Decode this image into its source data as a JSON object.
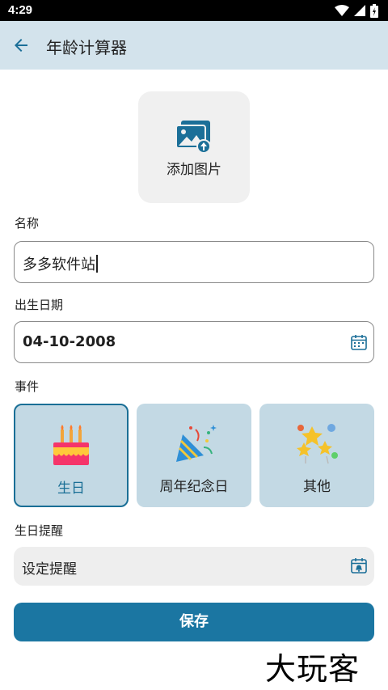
{
  "status_bar": {
    "time": "4:29"
  },
  "app_bar": {
    "title": "年龄计算器",
    "back_icon": "arrow-left-icon"
  },
  "add_image": {
    "label": "添加图片",
    "icon": "image-upload-icon"
  },
  "name_field": {
    "label": "名称",
    "value": "多多软件站"
  },
  "birth_field": {
    "label": "出生日期",
    "value": "04-10-2008",
    "icon": "calendar-icon"
  },
  "event": {
    "label": "事件",
    "options": [
      {
        "label": "生日",
        "icon": "birthday-cake-icon",
        "selected": true
      },
      {
        "label": "周年纪念日",
        "icon": "party-popper-icon",
        "selected": false
      },
      {
        "label": "其他",
        "icon": "stars-icon",
        "selected": false
      }
    ]
  },
  "reminder": {
    "label": "生日提醒",
    "value": "设定提醒",
    "icon": "calendar-bell-icon"
  },
  "save_label": "保存",
  "watermark": "大玩客",
  "colors": {
    "accent": "#1b76a2",
    "app_bar": "#d3e3ec",
    "card": "#c3d9e4"
  }
}
